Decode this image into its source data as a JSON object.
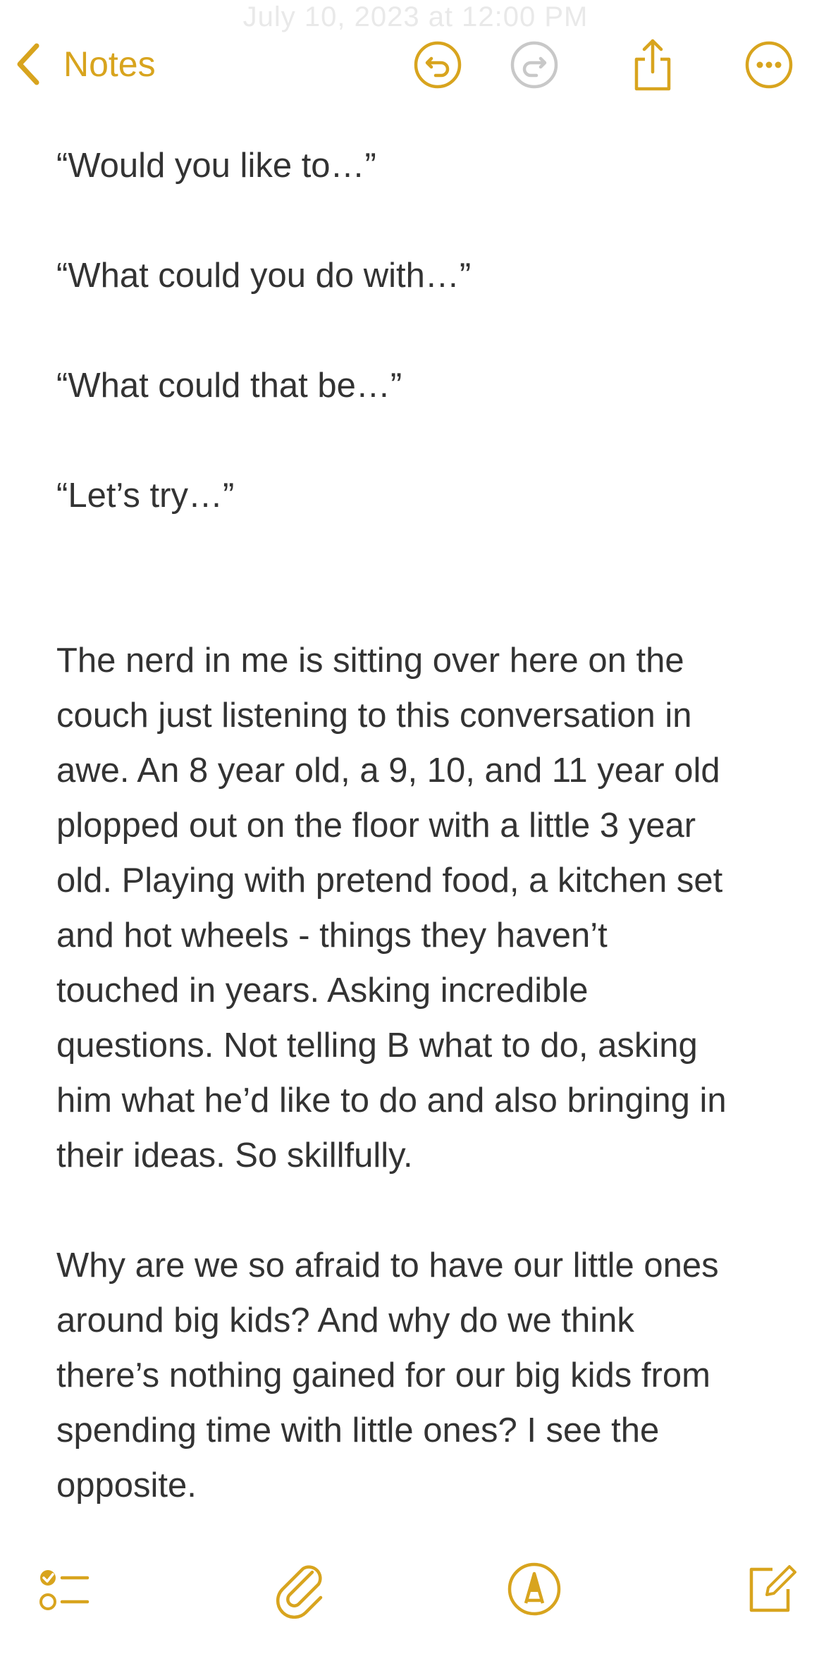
{
  "status": {
    "faded_date": "July 10, 2023 at 12:00 PM"
  },
  "nav": {
    "back_label": "Notes",
    "icons": [
      "undo-icon",
      "redo-icon",
      "share-icon",
      "more-icon"
    ]
  },
  "note": {
    "prompts": [
      "“Would you like to…”",
      "“What could you do with…”",
      "“What could that be…”",
      "“Let’s try…”"
    ],
    "paragraph1_lines": [
      "The nerd in me is sitting over here on the",
      "couch just listening to this conversation in",
      "awe. An 8 year old, a 9, 10, and 11 year old",
      "plopped out on the floor with a little 3 year",
      "old. Playing with pretend food, a kitchen set",
      "and hot wheels - things they haven’t",
      "touched in years. Asking incredible",
      "questions. Not telling B what to do, asking",
      "him what he’d like to do and also bringing in",
      "their ideas. So skillfully."
    ],
    "paragraph2_lines": [
      "Why are we so afraid to have our little ones",
      "around big kids? And why do we think",
      "there’s nothing gained for our big kids from",
      "spending time with little ones? I see the",
      "opposite."
    ]
  },
  "toolbar": {
    "icons": [
      "checklist-icon",
      "attachment-icon",
      "markup-icon",
      "compose-icon"
    ]
  },
  "colors": {
    "accent": "#d8a41e",
    "text": "#333333",
    "disabled": "#c8c8c8",
    "background": "#ffffff"
  }
}
